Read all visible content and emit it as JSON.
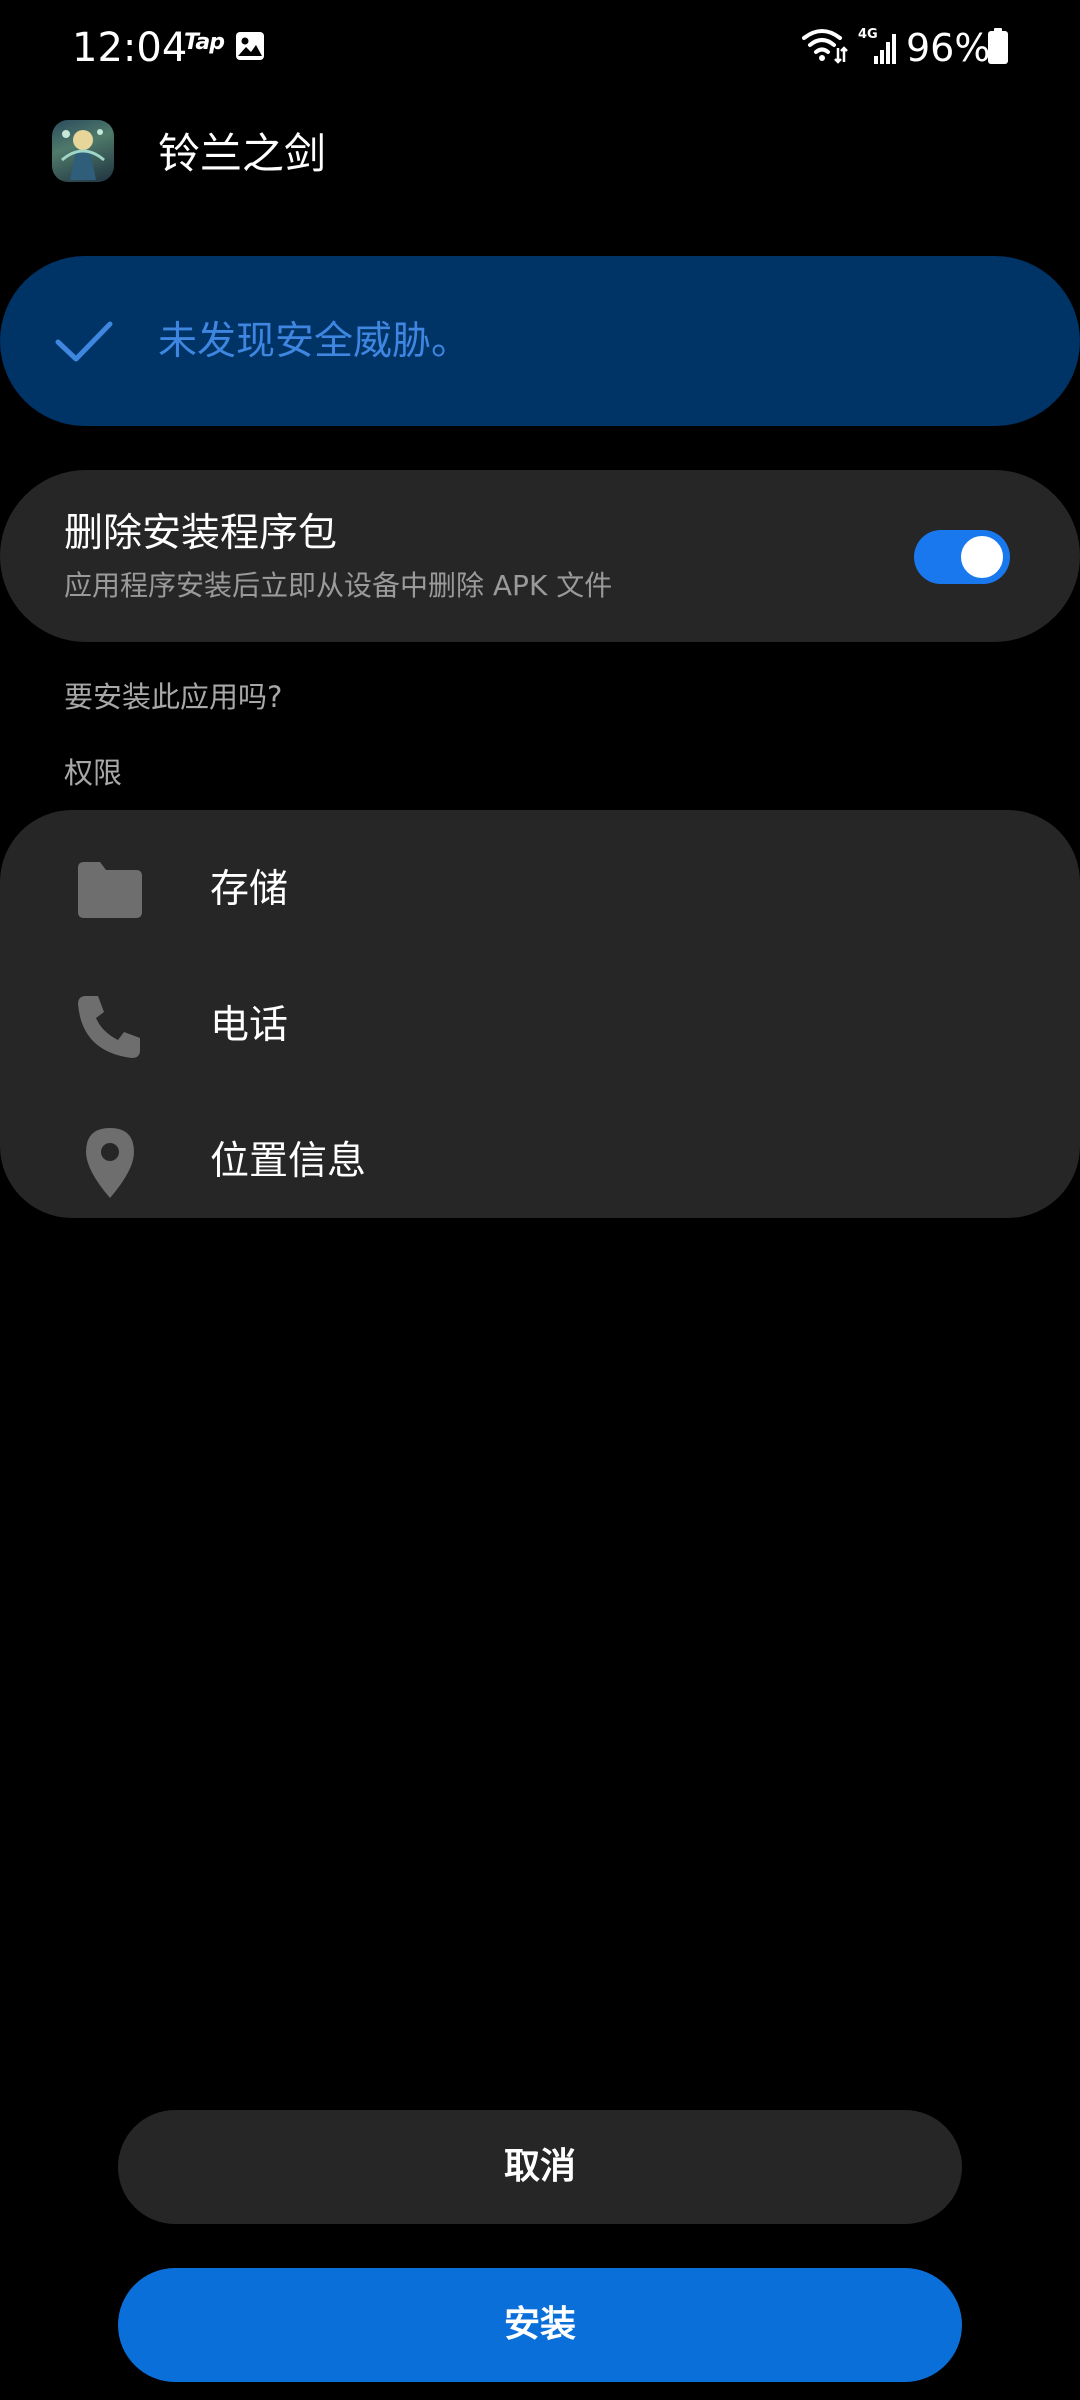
{
  "status_bar": {
    "time": "12:04",
    "tap_label": "Tap",
    "network_type": "4G",
    "battery_percent": "96%",
    "icons": [
      "image-icon",
      "wifi-icon",
      "signal-icon",
      "battery-icon"
    ]
  },
  "app": {
    "name": "铃兰之剑",
    "icon": "app-icon"
  },
  "security": {
    "message": "未发现安全威胁。",
    "icon": "check-icon",
    "accent_color": "#3e86e0"
  },
  "delete_package": {
    "title": "删除安装程序包",
    "subtitle": "应用程序安装后立即从设备中删除 APK 文件",
    "toggle_on": true,
    "toggle_color": "#1a78ee"
  },
  "install_question": "要安装此应用吗?",
  "permissions": {
    "label": "权限",
    "items": [
      {
        "label": "存储",
        "icon": "folder-icon"
      },
      {
        "label": "电话",
        "icon": "phone-icon"
      },
      {
        "label": "位置信息",
        "icon": "location-icon"
      }
    ]
  },
  "buttons": {
    "cancel": "取消",
    "install": "安装",
    "install_color": "#0b6fd9"
  }
}
